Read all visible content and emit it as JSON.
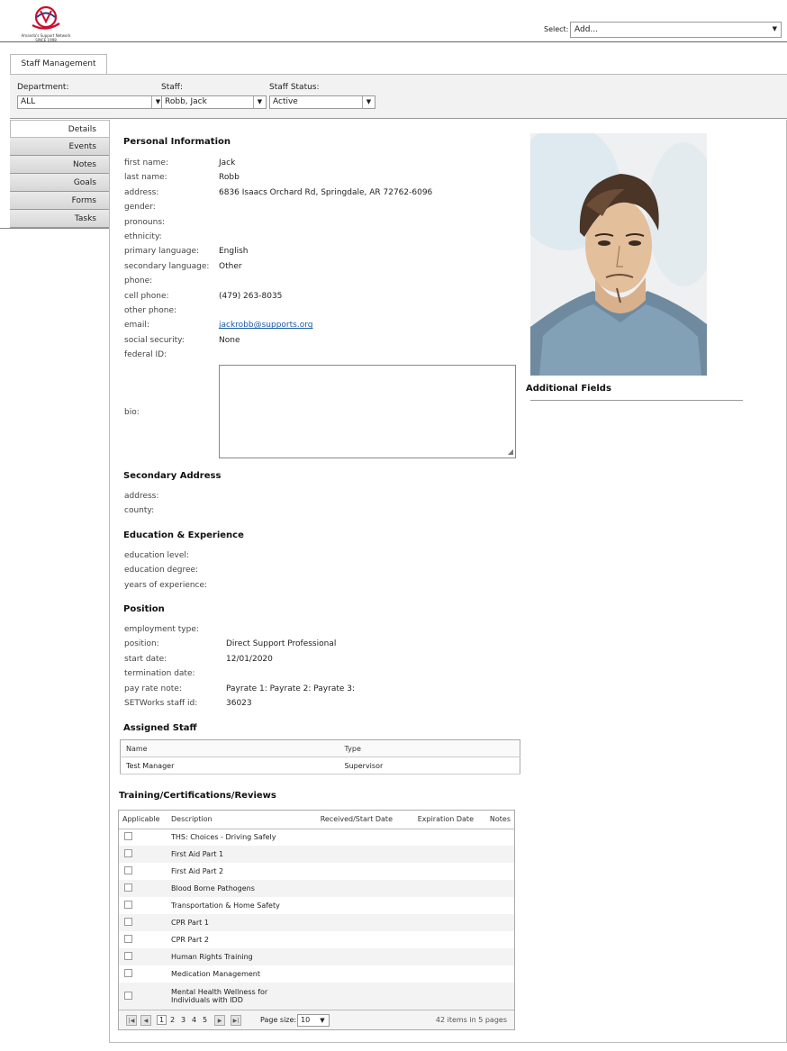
{
  "header": {
    "logo_text": "Amanda's Support Network",
    "logo_subtext": "SINCE 1998",
    "select_label": "Select:",
    "select_value": "Add..."
  },
  "tab": {
    "label": "Staff Management"
  },
  "filters": {
    "department_label": "Department:",
    "department_value": "ALL",
    "staff_label": "Staff:",
    "staff_value": "Robb, Jack",
    "status_label": "Staff Status:",
    "status_value": "Active"
  },
  "sidetabs": [
    "Details",
    "Events",
    "Notes",
    "Goals",
    "Forms",
    "Tasks"
  ],
  "personal": {
    "title": "Personal Information",
    "fields": [
      {
        "label": "first name:",
        "value": "Jack"
      },
      {
        "label": "last name:",
        "value": "Robb"
      },
      {
        "label": "address:",
        "value": "6836 Isaacs Orchard Rd, Springdale, AR 72762-6096"
      },
      {
        "label": "gender:",
        "value": ""
      },
      {
        "label": "pronouns:",
        "value": ""
      },
      {
        "label": "ethnicity:",
        "value": ""
      },
      {
        "label": "primary language:",
        "value": "English"
      },
      {
        "label": "secondary language:",
        "value": "Other"
      },
      {
        "label": "phone:",
        "value": ""
      },
      {
        "label": "cell phone:",
        "value": "(479) 263-8035"
      },
      {
        "label": "other phone:",
        "value": ""
      },
      {
        "label": "email:",
        "value": "jackrobb@supports.org"
      },
      {
        "label": "social security:",
        "value": "None"
      },
      {
        "label": "federal ID:",
        "value": ""
      }
    ],
    "bio_label": "bio:"
  },
  "additional_fields_title": "Additional Fields",
  "secondary": {
    "title": "Secondary Address",
    "fields": [
      {
        "label": "address:",
        "value": ""
      },
      {
        "label": "county:",
        "value": ""
      }
    ]
  },
  "education": {
    "title": "Education & Experience",
    "fields": [
      {
        "label": "education level:",
        "value": ""
      },
      {
        "label": "education degree:",
        "value": ""
      },
      {
        "label": "years of experience:",
        "value": ""
      }
    ]
  },
  "position": {
    "title": "Position",
    "fields": [
      {
        "label": "employment type:",
        "value": ""
      },
      {
        "label": "position:",
        "value": "Direct Support Professional"
      },
      {
        "label": "start date:",
        "value": "12/01/2020"
      },
      {
        "label": "termination date:",
        "value": ""
      },
      {
        "label": "pay rate note:",
        "value": "Payrate 1: Payrate 2: Payrate 3:"
      },
      {
        "label": "SETWorks staff id:",
        "value": "36023"
      }
    ]
  },
  "assigned": {
    "title": "Assigned Staff",
    "headers": [
      "Name",
      "Type"
    ],
    "rows": [
      [
        "Test Manager",
        "Supervisor"
      ]
    ]
  },
  "training": {
    "title": "Training/Certifications/Reviews",
    "headers": [
      "Applicable",
      "Description",
      "Received/Start Date",
      "Expiration Date",
      "Notes"
    ],
    "rows": [
      "THS: Choices - Driving Safely",
      "First Aid Part 1",
      "First Aid Part 2",
      "Blood Borne Pathogens",
      "Transportation & Home Safety",
      "CPR Part 1",
      "CPR Part 2",
      "Human Rights Training",
      "Medication Management",
      "Mental Health Wellness for Individuals with IDD"
    ],
    "pager": {
      "pages": [
        "1",
        "2",
        "3",
        "4",
        "5"
      ],
      "page_size_label": "Page size:",
      "page_size": "10",
      "summary": "42 items in 5 pages"
    }
  }
}
